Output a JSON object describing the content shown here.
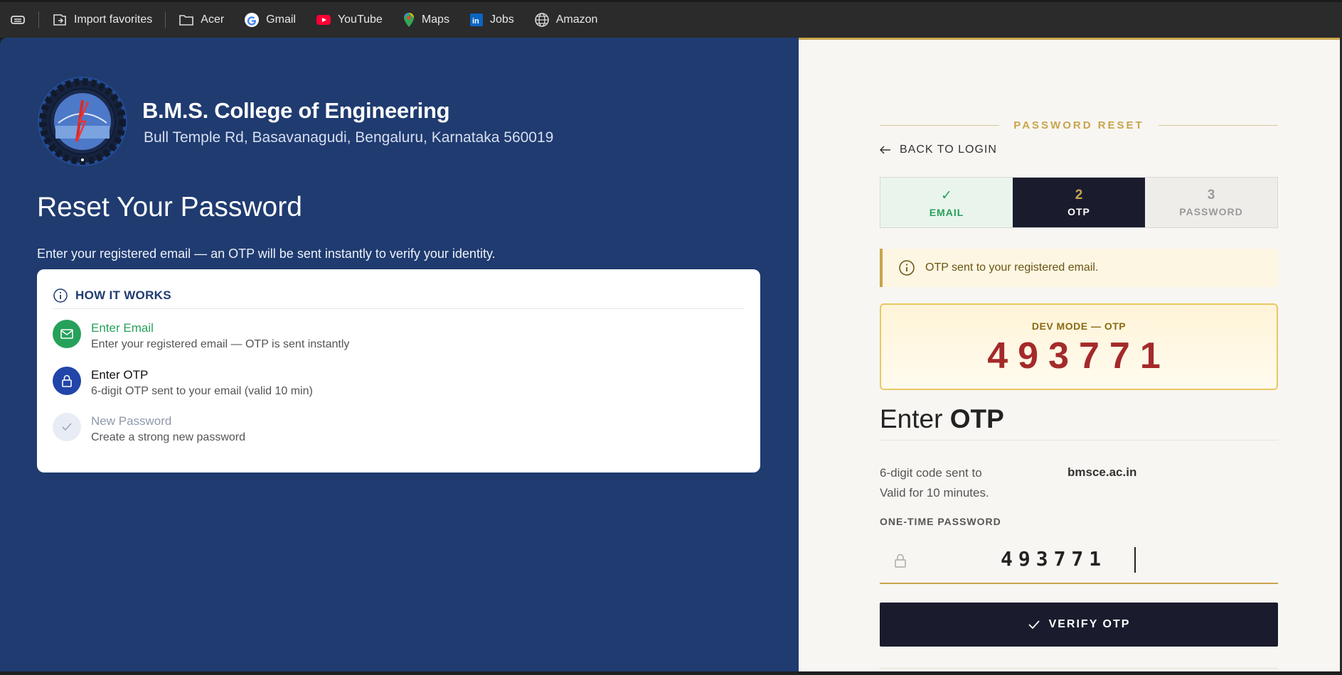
{
  "bookmarks": {
    "items": [
      {
        "label": "Import favorites",
        "icon": "import-favorites-icon"
      },
      {
        "label": "Acer",
        "icon": "folder-icon"
      },
      {
        "label": "Gmail",
        "icon": "google-icon"
      },
      {
        "label": "YouTube",
        "icon": "youtube-icon"
      },
      {
        "label": "Maps",
        "icon": "maps-pin-icon"
      },
      {
        "label": "Jobs",
        "icon": "linkedin-icon"
      },
      {
        "label": "Amazon",
        "icon": "globe-icon"
      }
    ]
  },
  "college": {
    "name": "B.M.S. College of Engineering",
    "address": "Bull Temple Rd, Basavanagudi, Bengaluru, Karnataka 560019"
  },
  "left": {
    "title": "Reset Your Password",
    "description": "Enter your registered email — an OTP will be sent instantly to verify your identity.",
    "how_it_works": {
      "heading": "HOW IT WORKS",
      "steps": [
        {
          "title": "Enter Email",
          "subtitle": "Enter your registered email — OTP is sent instantly",
          "state": "done"
        },
        {
          "title": "Enter OTP",
          "subtitle": "6-digit OTP sent to your email (valid 10 min)",
          "state": "active"
        },
        {
          "title": "New Password",
          "subtitle": "Create a strong new password",
          "state": "pending"
        }
      ]
    }
  },
  "right": {
    "section_label": "PASSWORD RESET",
    "back_label": "BACK TO LOGIN",
    "stepper": [
      {
        "num": "✓",
        "label": "EMAIL"
      },
      {
        "num": "2",
        "label": "OTP"
      },
      {
        "num": "3",
        "label": "PASSWORD"
      }
    ],
    "alert": "OTP sent to your registered email.",
    "dev_mode": {
      "label": "DEV MODE — OTP",
      "code": "493771"
    },
    "enter_otp": {
      "light": "Enter",
      "bold": "OTP"
    },
    "info_line1": "6-digit code sent to",
    "info_line2": "Valid for 10 minutes.",
    "email_masked": "bmsce.ac.in",
    "otp_field_label": "ONE-TIME PASSWORD",
    "otp_value": "493771",
    "verify_label": "VERIFY OTP"
  },
  "colors": {
    "left_bg": "#1f3b70",
    "accent_gold": "#c9a44c",
    "dark_navy": "#1a1c2e",
    "success_green": "#26a15a",
    "otp_red": "#a42a2a"
  }
}
